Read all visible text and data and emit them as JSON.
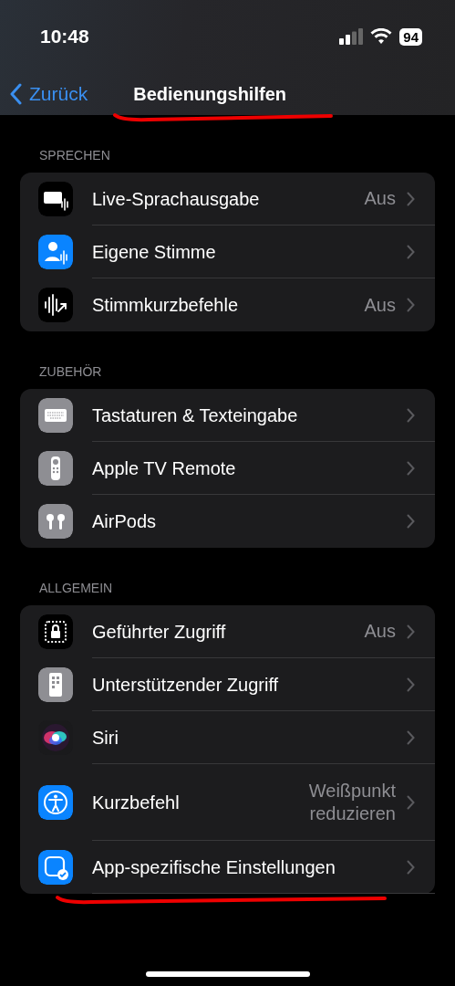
{
  "status_bar": {
    "time": "10:48",
    "battery": "94"
  },
  "nav": {
    "back": "Zurück",
    "title": "Bedienungshilfen",
    "underlined": true
  },
  "sections": [
    {
      "header": "SPRECHEN",
      "rows": [
        {
          "label": "Live-Sprachausgabe",
          "value": "Aus",
          "underlined": false
        },
        {
          "label": "Eigene Stimme",
          "underlined": false
        },
        {
          "label": "Stimmkurzbefehle",
          "value": "Aus",
          "underlined": false
        }
      ]
    },
    {
      "header": "ZUBEHÖR",
      "rows": [
        {
          "label": "Tastaturen & Texteingabe",
          "underlined": false
        },
        {
          "label": "Apple TV Remote",
          "underlined": false
        },
        {
          "label": "AirPods",
          "underlined": false
        }
      ]
    },
    {
      "header": "ALLGEMEIN",
      "rows": [
        {
          "label": "Geführter Zugriff",
          "value": "Aus",
          "underlined": false
        },
        {
          "label": "Unterstützender Zugriff",
          "underlined": false
        },
        {
          "label": "Siri",
          "underlined": false
        },
        {
          "label": "Kurzbefehl",
          "value": "Weißpunkt reduzieren",
          "underlined": false
        },
        {
          "label": "App-spezifische Einstellungen",
          "underlined": true
        }
      ]
    }
  ]
}
